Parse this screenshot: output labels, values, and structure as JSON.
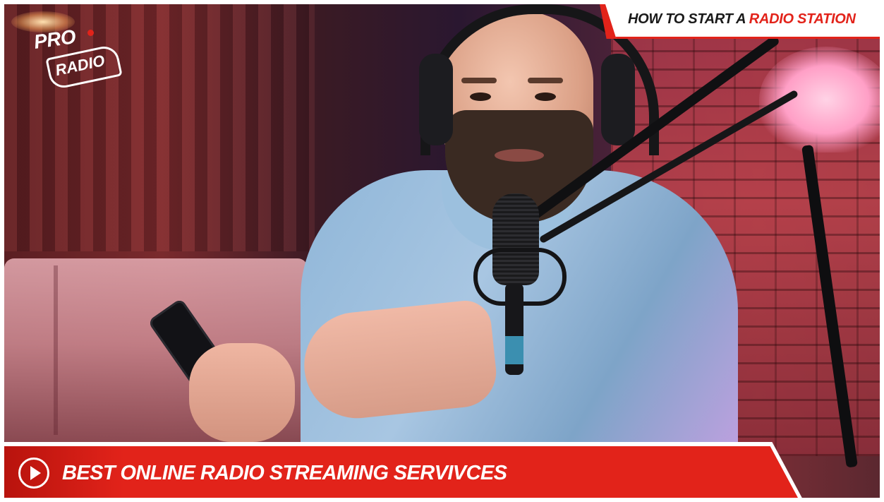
{
  "logo": {
    "line1": "PRO",
    "line2": "RADIO"
  },
  "top_title": {
    "prefix": "HOW TO START A ",
    "highlight": "RADIO STATION"
  },
  "bottom_title": "BEST ONLINE RADIO STREAMING SERVIVCES",
  "icons": {
    "play": "play-circle-icon"
  },
  "colors": {
    "brand_red": "#e2231a",
    "white": "#ffffff",
    "dark_text": "#1a1a1a"
  }
}
